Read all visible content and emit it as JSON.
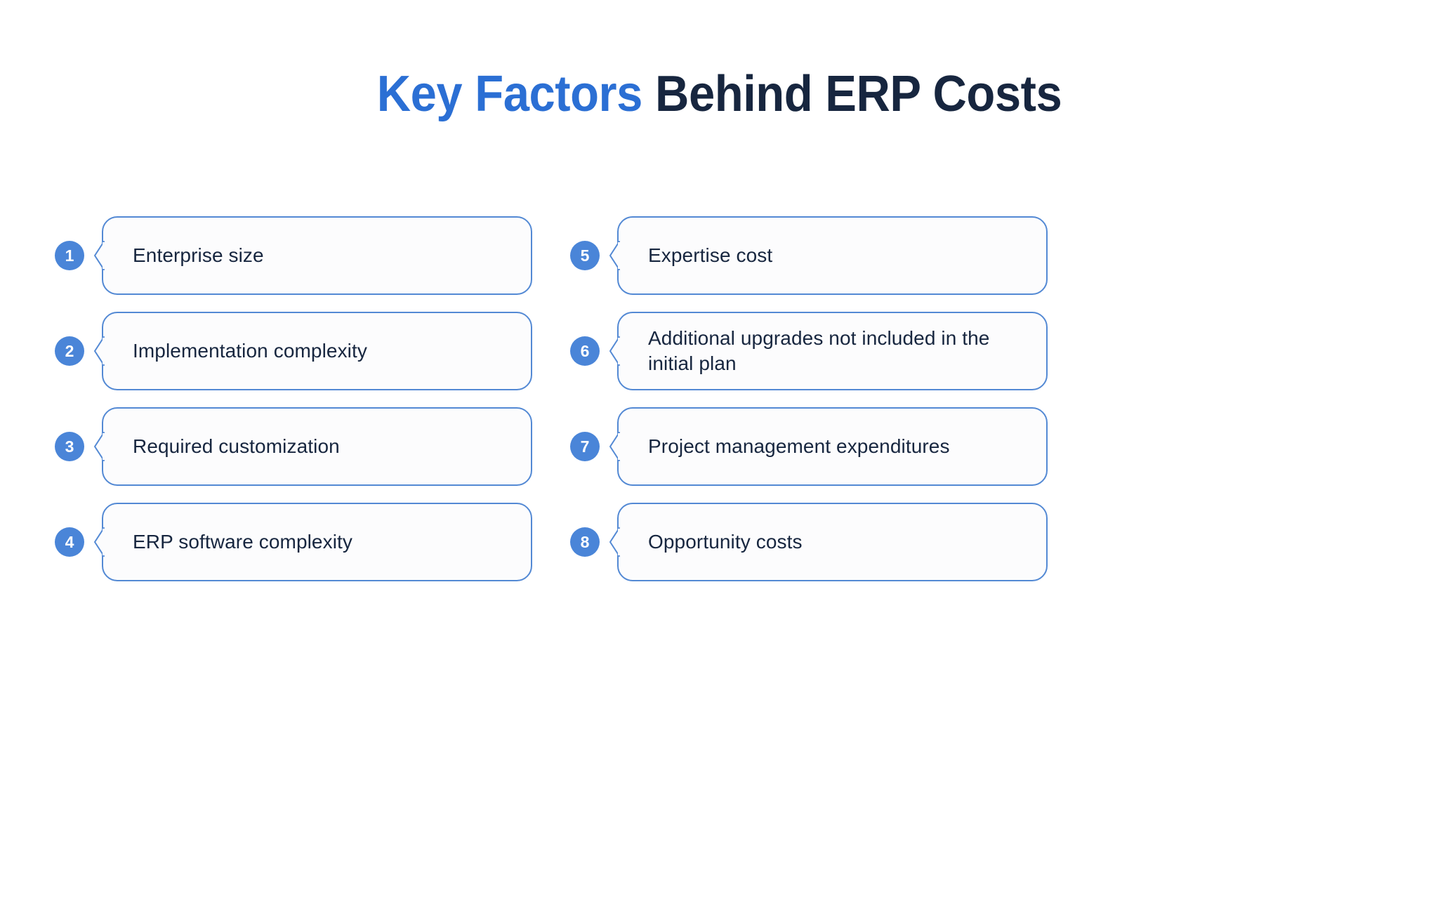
{
  "page": {
    "background_color": "#FFFFFF"
  },
  "title": {
    "accent_text": "Key Factors",
    "main_text": " Behind ERP Costs",
    "accent_color": "#2B6FD4",
    "main_color": "#17263F"
  },
  "theme": {
    "badge_fill": "#4A85D8",
    "badge_text_color": "#FFFFFF",
    "card_border": "#5389D4",
    "card_fill": "#FCFCFD",
    "card_text_color": "#17263F"
  },
  "columns": {
    "left": {
      "items": [
        {
          "number": "1",
          "label": "Enterprise size"
        },
        {
          "number": "2",
          "label": "Implementation complexity"
        },
        {
          "number": "3",
          "label": "Required customization"
        },
        {
          "number": "4",
          "label": "ERP software complexity"
        }
      ]
    },
    "right": {
      "items": [
        {
          "number": "5",
          "label": "Expertise cost"
        },
        {
          "number": "6",
          "label": "Additional upgrades not included in the initial plan"
        },
        {
          "number": "7",
          "label": "Project management expenditures"
        },
        {
          "number": "8",
          "label": "Opportunity costs"
        }
      ]
    }
  }
}
